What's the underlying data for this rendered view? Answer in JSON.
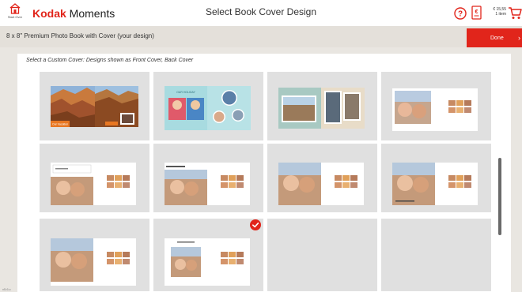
{
  "header": {
    "start_over_label": "Start Over",
    "brand_kodak": "Kodak",
    "brand_moments": " Moments",
    "page_title": "Select Book Cover Design",
    "cart_price": "€ 15,55",
    "cart_items": "1 item"
  },
  "product_bar": {
    "product_name": "8 x 8\" Premium Photo Book with Cover (your design)",
    "done_label": "Done"
  },
  "main": {
    "instructions": "Select a Custom Cover:  Designs shown as Front Cover, Back Cover",
    "cover_designs": [
      {
        "name": "canyon-adventure",
        "selected": false
      },
      {
        "name": "our-holiday",
        "selected": false
      },
      {
        "name": "travel-scrapbook",
        "selected": false
      },
      {
        "name": "white-grid-1",
        "selected": false
      },
      {
        "name": "white-grid-2",
        "selected": false
      },
      {
        "name": "white-grid-3",
        "selected": false
      },
      {
        "name": "white-grid-4",
        "selected": false
      },
      {
        "name": "white-grid-5",
        "selected": false
      },
      {
        "name": "white-grid-6",
        "selected": false
      },
      {
        "name": "white-grid-7",
        "selected": true
      }
    ],
    "cover_texts": {
      "canyon_title": "Our Vacation",
      "holiday_title": "OUR HOLIDAY"
    }
  },
  "footer": {
    "version": "v5.6.c"
  },
  "colors": {
    "accent": "#e1251b",
    "tile_bg": "#e0e0e0",
    "product_bar_bg": "#e4e0da"
  },
  "icons": {
    "start_over": "home-icon",
    "help": "question-circle-icon",
    "pricing": "euro-document-icon",
    "cart": "shopping-cart-icon",
    "done": "chevron-right-icon",
    "selected": "checkmark-icon"
  }
}
